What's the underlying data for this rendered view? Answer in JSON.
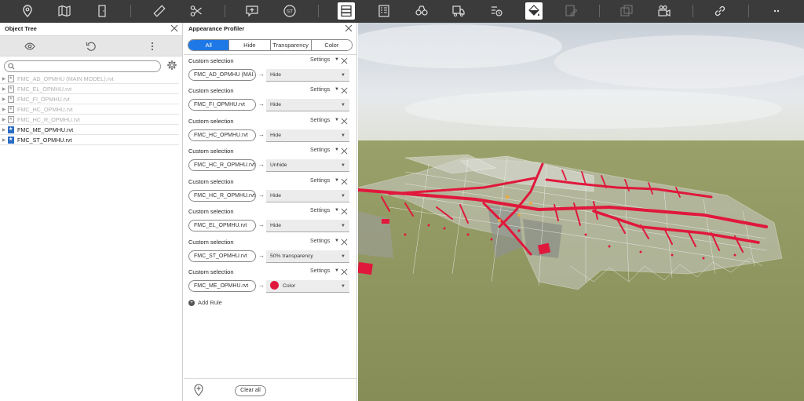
{
  "object_tree": {
    "title": "Object Tree",
    "search": {
      "value": "",
      "placeholder": ""
    },
    "items": [
      {
        "label": "FMC_AD_OPMHU (MAIN MODEL).rvt",
        "visible": false
      },
      {
        "label": "FMC_EL_OPMHU.rvt",
        "visible": false
      },
      {
        "label": "FMC_FI_OPMHU.rvt",
        "visible": false
      },
      {
        "label": "FMC_HC_OPMHU.rvt",
        "visible": false
      },
      {
        "label": "FMC_HC_R_OPMHU.rvt",
        "visible": false
      },
      {
        "label": "FMC_ME_OPMHU.rvt",
        "visible": true
      },
      {
        "label": "FMC_ST_OPMHU.rvt",
        "visible": true
      }
    ]
  },
  "profiler": {
    "title": "Appearance Profiler",
    "tabs": [
      {
        "label": "All",
        "active": true
      },
      {
        "label": "Hide",
        "active": false
      },
      {
        "label": "Transparency",
        "active": false
      },
      {
        "label": "Color",
        "active": false
      }
    ],
    "rules": [
      {
        "title": "Custom selection",
        "settings": "Settings",
        "selection": "FMC_AD_OPMHU (MAI...",
        "action": "Hide"
      },
      {
        "title": "Custom selection",
        "settings": "Settings",
        "selection": "FMC_FI_OPMHU.rvt",
        "action": "Hide"
      },
      {
        "title": "Custom selection",
        "settings": "Settings",
        "selection": "FMC_HC_OPMHU.rvt",
        "action": "Hide"
      },
      {
        "title": "Custom selection",
        "settings": "Settings",
        "selection": "FMC_HC_R_OPMHU.rvt",
        "action": "Unhide"
      },
      {
        "title": "Custom selection",
        "settings": "Settings",
        "selection": "FMC_HC_R_OPMHU.rvt",
        "action": "Hide"
      },
      {
        "title": "Custom selection",
        "settings": "Settings",
        "selection": "FMC_EL_OPMHU.rvt",
        "action": "Hide"
      },
      {
        "title": "Custom selection",
        "settings": "Settings",
        "selection": "FMC_ST_OPMHU.rvt",
        "action": "50% transparency"
      },
      {
        "title": "Custom selection",
        "settings": "Settings",
        "selection": "FMC_ME_OPMHU.rvt",
        "action": "Color",
        "color": "#e0183c"
      }
    ],
    "add_rule": "Add Rule",
    "clear_all": "Clear all"
  },
  "toolbar": {
    "items": [
      {
        "icon": "location-pin-icon"
      },
      {
        "icon": "map-icon"
      },
      {
        "icon": "door-icon"
      },
      {
        "icon": "ruler-icon"
      },
      {
        "icon": "scissors-icon"
      },
      {
        "icon": "annotation-icon"
      },
      {
        "icon": "st-icon",
        "text": "ST"
      },
      {
        "icon": "layers-icon"
      },
      {
        "icon": "properties-icon"
      },
      {
        "icon": "binoculars-icon"
      },
      {
        "icon": "vehicle-icon"
      },
      {
        "icon": "timeline-icon"
      },
      {
        "icon": "paint-bucket-icon"
      },
      {
        "icon": "markup-icon"
      },
      {
        "icon": "clone-icon"
      },
      {
        "icon": "camera-icon"
      },
      {
        "icon": "link-icon"
      },
      {
        "icon": "more-icon"
      }
    ]
  },
  "colors": {
    "accent": "#1e78e6",
    "model_red": "#e0183c",
    "toolbar_bg": "#3b3b3b",
    "ground": "#8c9460",
    "sky": "#d9dfe6"
  }
}
